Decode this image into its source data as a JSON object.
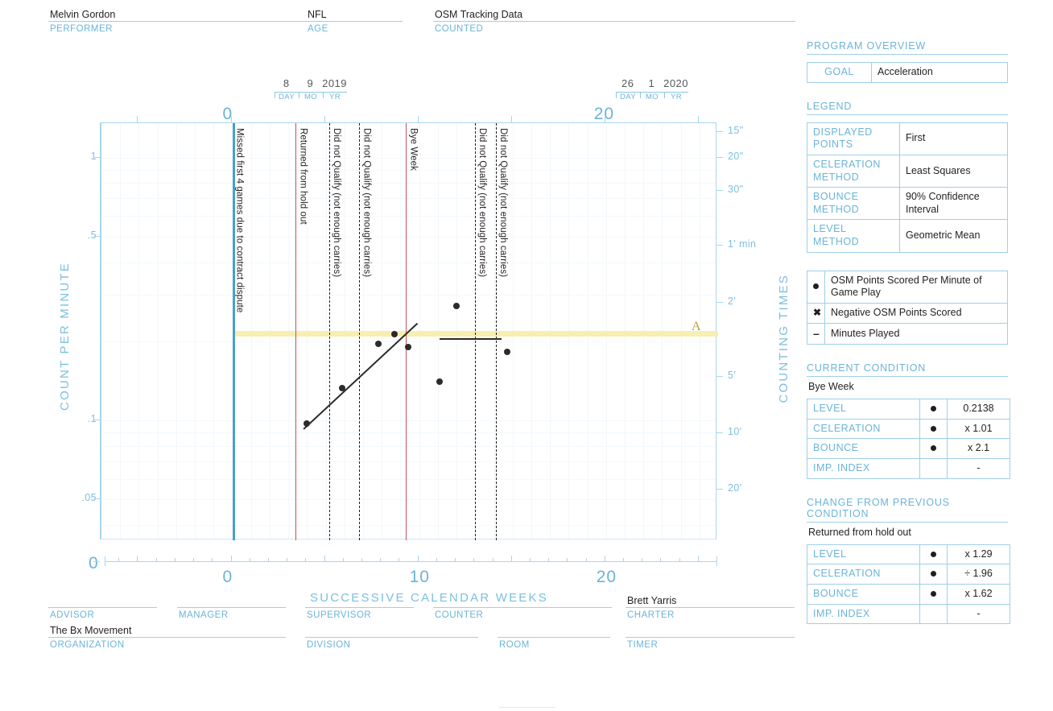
{
  "header": {
    "performer": {
      "value": "Melvin Gordon",
      "label": "PERFORMER"
    },
    "age": {
      "value": "NFL",
      "label": "AGE"
    },
    "counted": {
      "value": "OSM Tracking Data",
      "label": "COUNTED"
    }
  },
  "date_start": {
    "day": "8",
    "mo": "9",
    "yr": "2019",
    "l_day": "DAY",
    "l_mo": "MO",
    "l_yr": "YR"
  },
  "date_end": {
    "day": "26",
    "mo": "1",
    "yr": "2020",
    "l_day": "DAY",
    "l_mo": "MO",
    "l_yr": "YR"
  },
  "footer": {
    "advisor": {
      "value": "",
      "label": "ADVISOR"
    },
    "manager": {
      "value": "",
      "label": "MANAGER"
    },
    "supervisor": {
      "value": "",
      "label": "SUPERVISOR"
    },
    "counter": {
      "value": "",
      "label": "COUNTER"
    },
    "charter": {
      "value": "Brett Yarris",
      "label": "CHARTER"
    },
    "organization": {
      "value": "The Bx Movement",
      "label": "ORGANIZATION"
    },
    "division": {
      "value": "",
      "label": "DIVISION"
    },
    "room": {
      "value": "",
      "label": "ROOM"
    },
    "timer": {
      "value": "",
      "label": "TIMER"
    }
  },
  "panel": {
    "program_overview": {
      "title": "PROGRAM OVERVIEW",
      "rows": [
        {
          "key": "GOAL",
          "value": "Acceleration"
        }
      ]
    },
    "legend": {
      "title": "LEGEND",
      "rows": [
        {
          "key": "DISPLAYED POINTS",
          "value": "First"
        },
        {
          "key": "CELERATION METHOD",
          "value": "Least Squares"
        },
        {
          "key": "BOUNCE METHOD",
          "value": "90% Confidence Interval"
        },
        {
          "key": "LEVEL METHOD",
          "value": "Geometric Mean"
        }
      ],
      "symbols": [
        {
          "glyph": "dot-marker-icon",
          "label": "OSM Points Scored Per Minute of Game Play"
        },
        {
          "glyph": "x-marker-icon",
          "label": "Negative OSM Points Scored"
        },
        {
          "glyph": "dash-marker-icon",
          "label": "Minutes Played"
        }
      ]
    },
    "current_condition": {
      "title": "CURRENT CONDITION",
      "note": "Bye Week",
      "rows": [
        {
          "key": "LEVEL",
          "mark": "dot-marker-icon",
          "value": "0.2138"
        },
        {
          "key": "CELERATION",
          "mark": "dot-marker-icon",
          "value": "x 1.01"
        },
        {
          "key": "BOUNCE",
          "mark": "dot-marker-icon",
          "value": "x 2.1"
        },
        {
          "key": "IMP. INDEX",
          "mark": "",
          "value": "-"
        }
      ]
    },
    "change_from_previous": {
      "title": "CHANGE FROM PREVIOUS CONDITION",
      "note": "Returned from hold out",
      "rows": [
        {
          "key": "LEVEL",
          "mark": "dot-marker-icon",
          "value": "x 1.29"
        },
        {
          "key": "CELERATION",
          "mark": "dot-marker-icon",
          "value": "÷ 1.96"
        },
        {
          "key": "BOUNCE",
          "mark": "dot-marker-icon",
          "value": "x 1.62"
        },
        {
          "key": "IMP. INDEX",
          "mark": "",
          "value": "-"
        }
      ]
    }
  },
  "chart_data": {
    "type": "scatter",
    "title": "",
    "xlabel": "SUCCESSIVE CALENDAR WEEKS",
    "ylabel": "COUNT PER MINUTE",
    "ylabel_right": "COUNTING TIMES",
    "y_scale": "log",
    "ylim": [
      0.035,
      1.35
    ],
    "xlim": [
      -7,
      26
    ],
    "grid": true,
    "y_ticks_left": [
      "1",
      ".5",
      ".1",
      ".05",
      "0"
    ],
    "y_ticks_right": [
      "15\"",
      "20\"",
      "30\"",
      "1' min",
      "2'",
      "5'",
      "10'",
      "20'"
    ],
    "x_ticks_bottom": [
      "0",
      "10",
      "20"
    ],
    "x_origin_label": "0",
    "x_ticks_top": [
      "0",
      "20"
    ],
    "aim_line": {
      "value": 0.2138,
      "color": "#f7efb0",
      "label": "A"
    },
    "phase_lines": [
      {
        "x": 0,
        "label": "Missed first 4 games due to contract dispute",
        "color": "#4a9fcc",
        "style": "solid",
        "width": 3
      },
      {
        "x": 3.4,
        "label": "Returned from hold out",
        "color": "#c4505a",
        "style": "solid",
        "width": 1
      },
      {
        "x": 5.2,
        "label": "Did not Qualify (not enough carries)",
        "color": "#1f1f1f",
        "style": "dashed",
        "width": 1
      },
      {
        "x": 6.8,
        "label": "Did not Qualify (not enough carries)",
        "color": "#1f1f1f",
        "style": "dashed",
        "width": 1
      },
      {
        "x": 9.3,
        "label": "Bye Week",
        "color": "#c4505a",
        "style": "solid",
        "width": 1
      },
      {
        "x": 13.0,
        "label": "Did not Qualify (not enough carries)",
        "color": "#1f1f1f",
        "style": "dashed",
        "width": 1
      },
      {
        "x": 14.1,
        "label": "Did not Qualify (not enough carries)",
        "color": "#1f1f1f",
        "style": "dashed",
        "width": 1
      }
    ],
    "series": [
      {
        "name": "OSM Points Scored Per Minute of Game Play",
        "marker": "dot",
        "points": [
          {
            "x": 4.0,
            "y": 0.097
          },
          {
            "x": 5.9,
            "y": 0.133
          },
          {
            "x": 7.8,
            "y": 0.196
          },
          {
            "x": 8.7,
            "y": 0.213
          },
          {
            "x": 9.4,
            "y": 0.19
          },
          {
            "x": 11.1,
            "y": 0.14
          },
          {
            "x": 12.0,
            "y": 0.272
          },
          {
            "x": 14.7,
            "y": 0.182
          }
        ]
      }
    ],
    "trend_lines": [
      {
        "from": {
          "x": 3.8,
          "y": 0.093
        },
        "to": {
          "x": 9.9,
          "y": 0.235
        },
        "color": "#2b2b2b"
      },
      {
        "from": {
          "x": 11.1,
          "y": 0.205
        },
        "to": {
          "x": 14.4,
          "y": 0.205
        },
        "color": "#2b2b2b"
      }
    ]
  }
}
